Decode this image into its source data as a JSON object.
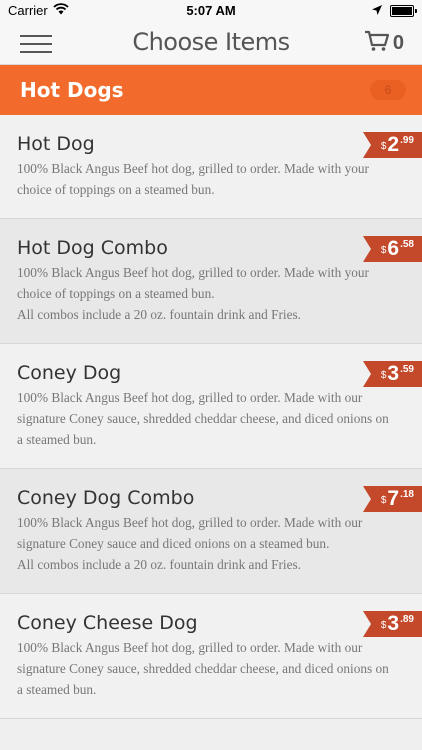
{
  "status": {
    "carrier": "Carrier",
    "time": "5:07 AM",
    "icons": [
      "wifi-icon",
      "location-icon",
      "battery-icon"
    ]
  },
  "nav": {
    "title": "Choose Items",
    "cart_count": "0",
    "icons": [
      "hamburger-menu-icon",
      "shopping-cart-icon"
    ]
  },
  "category": {
    "name": "Hot Dogs",
    "count": "6"
  },
  "colors": {
    "accent": "#f26b2c",
    "price_tag": "#c4482a"
  },
  "items": [
    {
      "title": "Hot Dog",
      "description": "100% Black Angus Beef hot dog, grilled to order. Made with your choice of toppings on a steamed bun.",
      "price_currency": "$",
      "price_dollars": "2",
      "price_cents": ".99"
    },
    {
      "title": "Hot Dog Combo",
      "description": "100% Black Angus Beef hot dog, grilled to order. Made with your choice of toppings on a steamed bun.\nAll combos include a 20 oz. fountain drink and Fries.",
      "price_currency": "$",
      "price_dollars": "6",
      "price_cents": ".58"
    },
    {
      "title": "Coney Dog",
      "description": "100% Black Angus Beef hot dog, grilled to order. Made with our signature Coney sauce, shredded cheddar cheese, and diced onions on a steamed bun.",
      "price_currency": "$",
      "price_dollars": "3",
      "price_cents": ".59"
    },
    {
      "title": "Coney Dog Combo",
      "description": "100% Black Angus Beef hot dog, grilled to order. Made with our signature Coney sauce and diced onions on a steamed bun.\nAll combos include a 20 oz. fountain drink and Fries.",
      "price_currency": "$",
      "price_dollars": "7",
      "price_cents": ".18"
    },
    {
      "title": "Coney Cheese Dog",
      "description": "100% Black Angus Beef hot dog, grilled to order. Made with our signature Coney sauce, shredded cheddar cheese, and diced onions on a steamed bun.",
      "price_currency": "$",
      "price_dollars": "3",
      "price_cents": ".89"
    }
  ]
}
